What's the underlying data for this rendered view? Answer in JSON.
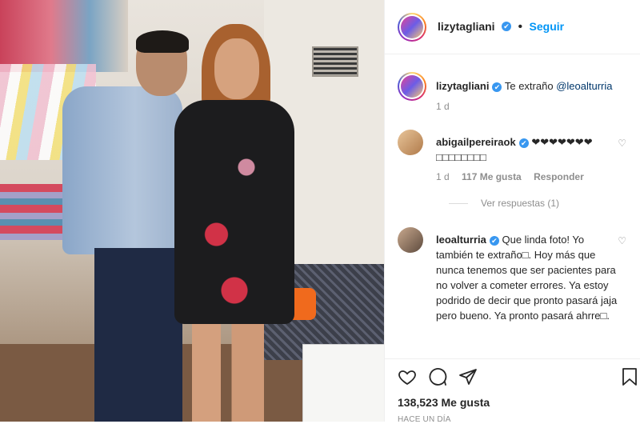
{
  "post": {
    "username": "lizytagliani",
    "verified_mark": "✔",
    "separator": "•",
    "follow_label": "Seguir"
  },
  "caption": {
    "username": "lizytagliani",
    "text": "Te extraño",
    "mention": "@leoalturria",
    "time": "1 d"
  },
  "comments": [
    {
      "username": "abigailpereiraok",
      "text": "❤❤❤❤❤❤❤ □□□□□□□□",
      "time": "1 d",
      "likes": "117 Me gusta",
      "reply": "Responder",
      "view_replies": "Ver respuestas (1)"
    },
    {
      "username": "leoalturria",
      "text": "Que linda foto! Yo también te extraño□. Hoy más que nunca tenemos que ser pacientes para no volver a cometer errores. Ya estoy podrido de decir que pronto pasará jaja pero bueno. Ya pronto pasará ahrre□."
    }
  ],
  "footer": {
    "likes": "138,523 Me gusta",
    "timestamp": "HACE UN DÍA"
  },
  "icons": [
    "heart-icon",
    "comment-icon",
    "share-icon",
    "bookmark-icon",
    "verified-icon"
  ],
  "colors": {
    "link": "#0095f6",
    "verified": "#3897f0",
    "muted": "#8e8e8e"
  }
}
